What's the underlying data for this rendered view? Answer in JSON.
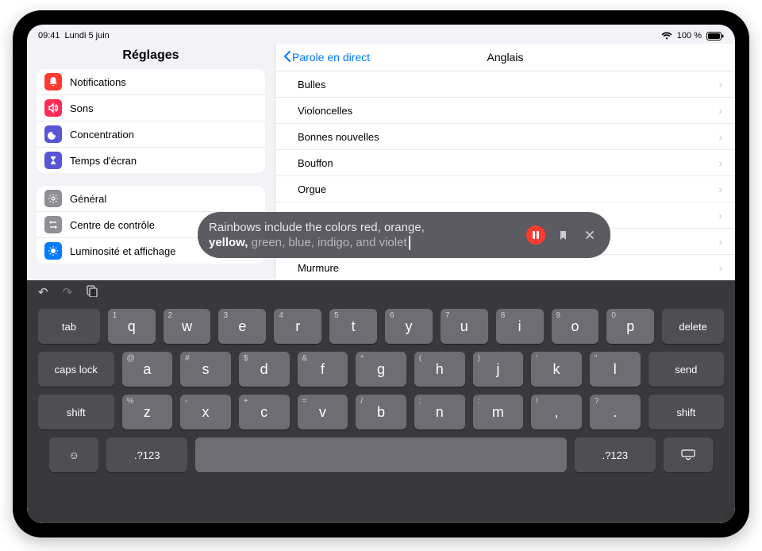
{
  "statusbar": {
    "time": "09:41",
    "date": "Lundi 5 juin",
    "battery": "100 %"
  },
  "sidebar": {
    "title": "Réglages",
    "group1": [
      {
        "icon": "bell",
        "bg": "#ff3b30",
        "label": "Notifications"
      },
      {
        "icon": "sound",
        "bg": "#ff2d55",
        "label": "Sons"
      },
      {
        "icon": "moon",
        "bg": "#5856d6",
        "label": "Concentration"
      },
      {
        "icon": "hourglass",
        "bg": "#5856d6",
        "label": "Temps d'écran"
      }
    ],
    "group2": [
      {
        "icon": "gear",
        "bg": "#8e8e93",
        "label": "Général"
      },
      {
        "icon": "switches",
        "bg": "#8e8e93",
        "label": "Centre de contrôle"
      },
      {
        "icon": "sun",
        "bg": "#007aff",
        "label": "Luminosité et affichage"
      }
    ]
  },
  "main": {
    "back": "Parole en direct",
    "title": "Anglais",
    "rows": [
      "Bulles",
      "Violoncelles",
      "Bonnes nouvelles",
      "Bouffon",
      "Orgue",
      "",
      "",
      "Murmure"
    ]
  },
  "live": {
    "spoken": "Rainbows include the colors red, orange,",
    "current": "yellow,",
    "pending": " green, blue, indigo, and violet"
  },
  "keyboard": {
    "row1": [
      {
        "k": "q",
        "h": "1"
      },
      {
        "k": "w",
        "h": "2"
      },
      {
        "k": "e",
        "h": "3"
      },
      {
        "k": "r",
        "h": "4"
      },
      {
        "k": "t",
        "h": "5"
      },
      {
        "k": "y",
        "h": "6"
      },
      {
        "k": "u",
        "h": "7"
      },
      {
        "k": "i",
        "h": "8"
      },
      {
        "k": "o",
        "h": "9"
      },
      {
        "k": "p",
        "h": "0"
      }
    ],
    "row2": [
      {
        "k": "a",
        "h": "@"
      },
      {
        "k": "s",
        "h": "#"
      },
      {
        "k": "d",
        "h": "$"
      },
      {
        "k": "f",
        "h": "&"
      },
      {
        "k": "g",
        "h": "*"
      },
      {
        "k": "h",
        "h": "("
      },
      {
        "k": "j",
        "h": ")"
      },
      {
        "k": "k",
        "h": "'"
      },
      {
        "k": "l",
        "h": "\""
      }
    ],
    "row3": [
      {
        "k": "z",
        "h": "%"
      },
      {
        "k": "x",
        "h": "-"
      },
      {
        "k": "c",
        "h": "+"
      },
      {
        "k": "v",
        "h": "="
      },
      {
        "k": "b",
        "h": "/"
      },
      {
        "k": "n",
        "h": ";"
      },
      {
        "k": "m",
        "h": ":"
      },
      {
        "k": ",",
        "h": "!"
      },
      {
        "k": ".",
        "h": "?"
      }
    ],
    "labels": {
      "tab": "tab",
      "delete": "delete",
      "caps": "caps lock",
      "send": "send",
      "shift": "shift",
      "numbers": ".?123"
    }
  }
}
